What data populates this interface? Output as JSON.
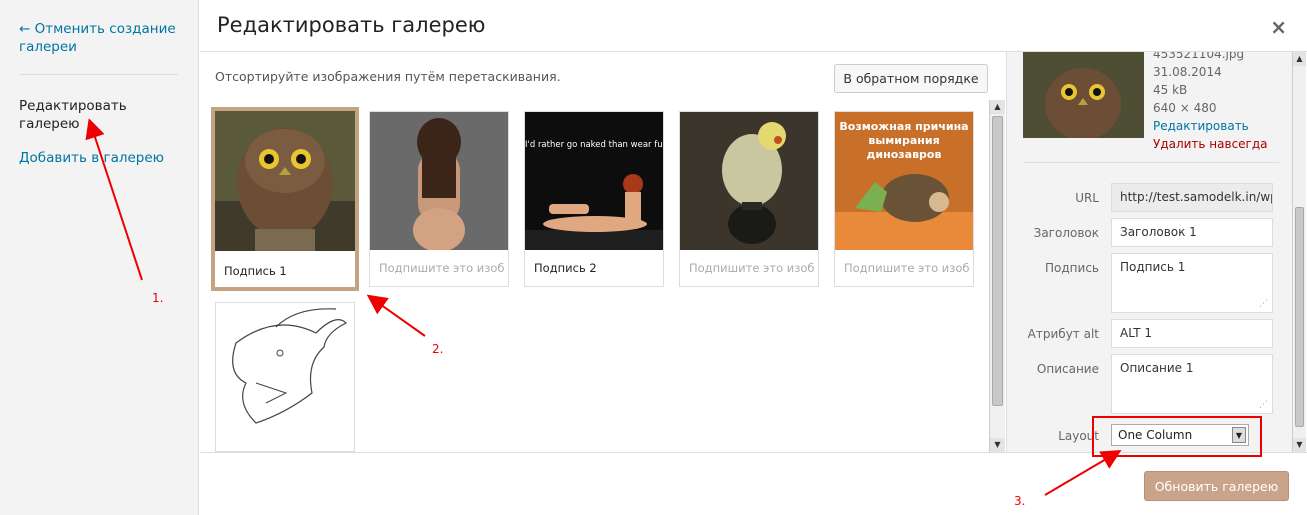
{
  "menu": {
    "cancel": "← Отменить создание галереи",
    "edit": "Редактировать галерею",
    "add": "Добавить в галерею"
  },
  "header": {
    "title": "Редактировать галерею",
    "close": "×"
  },
  "toolbar": {
    "instructions": "Отсортируйте изображения путём перетаскивания.",
    "reverse": "В обратном порядке"
  },
  "gallery": [
    {
      "caption": "Подпись 1",
      "placeholder": "",
      "overlay": ""
    },
    {
      "caption": "",
      "placeholder": "Подпишите это изоб",
      "overlay": ""
    },
    {
      "caption": "Подпись 2",
      "placeholder": "",
      "overlay": "I'd rather go naked than wear fur"
    },
    {
      "caption": "",
      "placeholder": "Подпишите это изоб",
      "overlay": ""
    },
    {
      "caption": "",
      "placeholder": "Подпишите это изоб",
      "overlay": "Возможная причина вымирания динозавров"
    },
    {
      "caption": "",
      "placeholder": "",
      "overlay": ""
    }
  ],
  "details": {
    "filename": "453521104.jpg",
    "date": "31.08.2014",
    "size": "45 kB",
    "dimensions": "640 × 480",
    "edit_link": "Редактировать",
    "delete_link": "Удалить навсегда"
  },
  "fields": {
    "url_label": "URL",
    "url_value": "http://test.samodelk.in/wp",
    "title_label": "Заголовок",
    "title_value": "Заголовок 1",
    "caption_label": "Подпись",
    "caption_value": "Подпись 1",
    "alt_label": "Атрибут alt",
    "alt_value": "ALT 1",
    "desc_label": "Описание",
    "desc_value": "Описание 1",
    "layout_label": "Layout",
    "layout_value": "One Column"
  },
  "footer": {
    "update": "Обновить галерею"
  },
  "annotations": [
    "1.",
    "2.",
    "3."
  ]
}
